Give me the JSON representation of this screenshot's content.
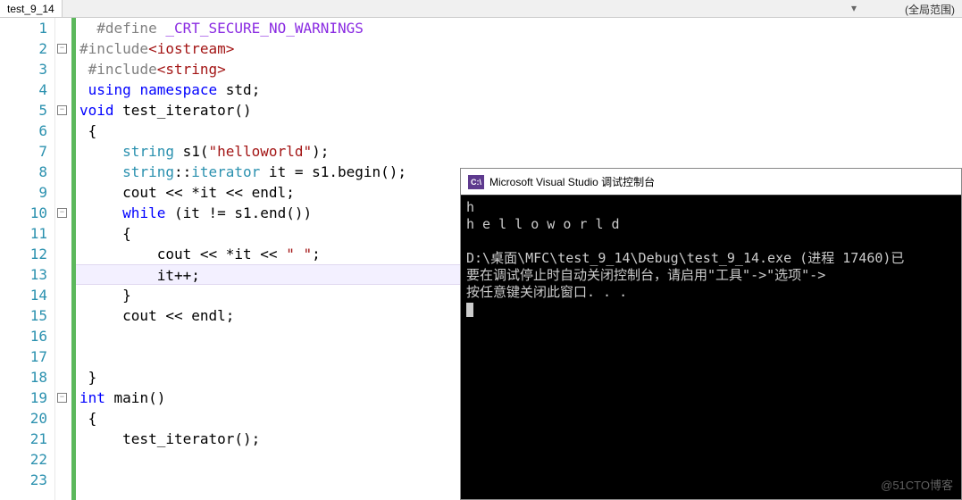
{
  "header": {
    "tab_name": "test_9_14",
    "scope_label": "(全局范围)"
  },
  "code": {
    "lines": [
      {
        "n": 1,
        "html": "  <span class='macro'>#define</span> <span class='define'>_CRT_SECURE_NO_WARNINGS</span>"
      },
      {
        "n": 2,
        "html": "<span class='macro'>#include</span><span class='str'>&lt;iostream&gt;</span>",
        "fold": true
      },
      {
        "n": 3,
        "html": " <span class='macro'>#include</span><span class='str'>&lt;string&gt;</span>"
      },
      {
        "n": 4,
        "html": " <span class='kw'>using</span> <span class='kw'>namespace</span> std;"
      },
      {
        "n": 5,
        "html": "<span class='kw'>void</span> test_iterator()",
        "fold": true
      },
      {
        "n": 6,
        "html": " {"
      },
      {
        "n": 7,
        "html": "     <span class='type'>string</span> s1(<span class='str'>\"helloworld\"</span>);"
      },
      {
        "n": 8,
        "html": "     <span class='type'>string</span>::<span class='type'>iterator</span> it = s1.begin();"
      },
      {
        "n": 9,
        "html": "     cout &lt;&lt; *it &lt;&lt; endl;"
      },
      {
        "n": 10,
        "html": "     <span class='kw'>while</span> (it != s1.end())",
        "fold": true
      },
      {
        "n": 11,
        "html": "     {"
      },
      {
        "n": 12,
        "html": "         cout &lt;&lt; *it &lt;&lt; <span class='str'>\" \"</span>;"
      },
      {
        "n": 13,
        "html": "         it++;",
        "highlight": true
      },
      {
        "n": 14,
        "html": "     }"
      },
      {
        "n": 15,
        "html": "     cout &lt;&lt; endl;"
      },
      {
        "n": 16,
        "html": ""
      },
      {
        "n": 17,
        "html": ""
      },
      {
        "n": 18,
        "html": " }"
      },
      {
        "n": 19,
        "html": "<span class='kw'>int</span> main()",
        "fold": true
      },
      {
        "n": 20,
        "html": " {"
      },
      {
        "n": 21,
        "html": "     test_iterator();"
      },
      {
        "n": 22,
        "html": ""
      },
      {
        "n": 23,
        "html": ""
      }
    ]
  },
  "console": {
    "title": "Microsoft Visual Studio 调试控制台",
    "icon_text": "C:\\",
    "lines": [
      "h",
      "h e l l o w o r l d",
      "",
      "D:\\桌面\\MFC\\test_9_14\\Debug\\test_9_14.exe (进程 17460)已",
      "要在调试停止时自动关闭控制台，请启用\"工具\"->\"选项\"->",
      "按任意键关闭此窗口. . ."
    ]
  },
  "watermark": "@51CTO博客"
}
